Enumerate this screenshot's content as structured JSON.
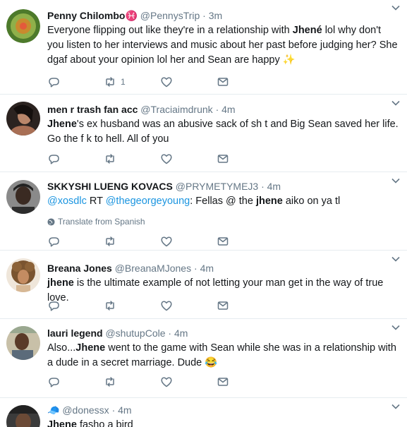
{
  "tweets": [
    {
      "name": "Penny Chilombo",
      "name_emoji": "♓",
      "handle": "@PennysTrip",
      "time": "3m",
      "text_segments": [
        {
          "t": "Everyone flipping out like they're in a relationship with "
        },
        {
          "t": "Jhené",
          "bold": true
        },
        {
          "t": " lol why don't you listen to her interviews and music about her past before judging her? She dgaf about your opinion lol her and Sean are happy "
        },
        {
          "t": "✨"
        }
      ],
      "retweets": "1"
    },
    {
      "name": "men r trash fan acc",
      "handle": "@Traciaimdrunk",
      "time": "4m",
      "text_segments": [
        {
          "t": "Jhene",
          "bold": true
        },
        {
          "t": "'s ex husband was an abusive sack of sh t and Big Sean saved her life. Go the f k to hell. All of you"
        }
      ],
      "retweets": ""
    },
    {
      "name": "SKKYSHI LUENG KOVACS",
      "handle": "@PRYMETYMEJ3",
      "time": "4m",
      "text_segments": [
        {
          "t": "@xosdlc",
          "link": true
        },
        {
          "t": " RT "
        },
        {
          "t": "@thegeorgeyoung",
          "link": true
        },
        {
          "t": ": Fellas @ the "
        },
        {
          "t": "jhene",
          "bold": true
        },
        {
          "t": " aiko on ya tl"
        }
      ],
      "translate": "Translate from Spanish",
      "retweets": ""
    },
    {
      "name": "Breana Jones",
      "handle": "@BreanaMJones",
      "time": "4m",
      "text_segments": [
        {
          "t": "jhene",
          "bold": true
        },
        {
          "t": " is the ultimate example of not letting your man get in the way of true love."
        }
      ],
      "retweets": ""
    },
    {
      "name": "lauri legend",
      "handle": "@shutupCole",
      "time": "4m",
      "text_segments": [
        {
          "t": "Also..."
        },
        {
          "t": "Jhene",
          "bold": true
        },
        {
          "t": " went to the game with Sean while she was in a relationship with a dude in a secret marriage. Dude "
        },
        {
          "t": "😂"
        }
      ],
      "retweets": ""
    },
    {
      "name": "🧢",
      "handle": "@donessx",
      "time": "4m",
      "text_segments": [
        {
          "t": "Jhene",
          "bold": true
        },
        {
          "t": " fasho a bird"
        }
      ],
      "retweets": ""
    }
  ],
  "icons": {
    "reply": "reply-icon",
    "retweet": "retweet-icon",
    "like": "heart-icon",
    "dm": "envelope-icon",
    "more": "chevron-down-icon",
    "globe": "globe-icon"
  },
  "colors": {
    "text": "#14171a",
    "secondary": "#657786",
    "link": "#1b95e0",
    "divider": "#e6ecf0"
  }
}
